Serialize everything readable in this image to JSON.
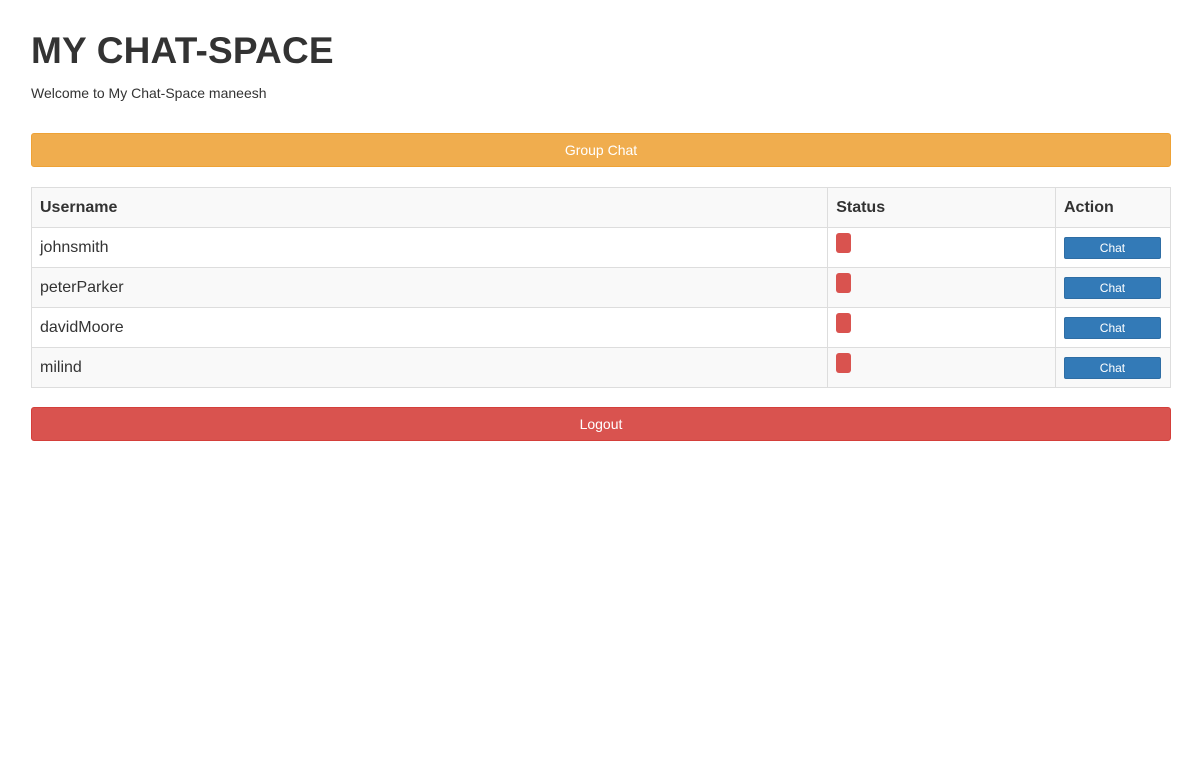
{
  "header": {
    "title": "MY CHAT-SPACE",
    "welcome": "Welcome to My Chat-Space maneesh"
  },
  "buttons": {
    "group_chat": "Group Chat",
    "logout": "Logout"
  },
  "table": {
    "columns": [
      "Username",
      "Status",
      "Action"
    ],
    "rows": [
      {
        "username": "johnsmith",
        "action": "Chat"
      },
      {
        "username": "peterParker",
        "action": "Chat"
      },
      {
        "username": "davidMoore",
        "action": "Chat"
      },
      {
        "username": "milind",
        "action": "Chat"
      }
    ]
  },
  "colors": {
    "group_chat": "#f0ad4e",
    "logout": "#d9534f",
    "status_offline": "#d9534f",
    "chat_button": "#337ab7"
  }
}
